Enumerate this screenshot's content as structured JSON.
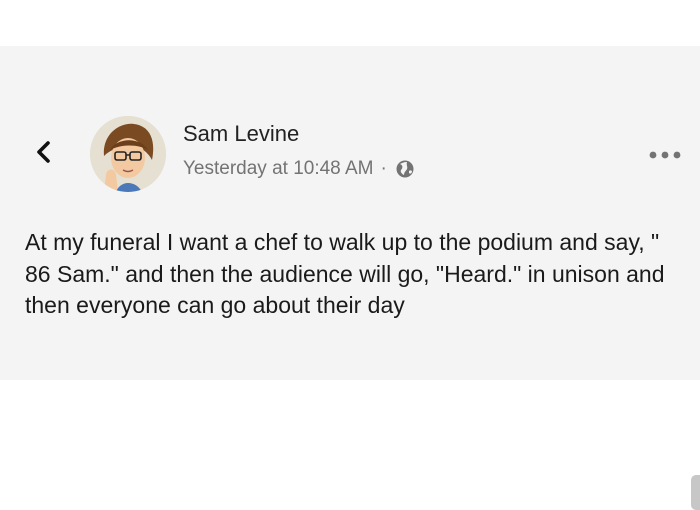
{
  "post": {
    "author": "Sam Levine",
    "timestamp": "Yesterday at 10:48 AM",
    "separator": "·",
    "privacy_icon": "globe-icon",
    "back_icon": "chevron-left-icon",
    "more_icon": "more-dots-icon",
    "text": "At my funeral I want a chef to walk up to the podium and say, \" 86 Sam.\" and then the audience will go, \"Heard.\" in unison and then everyone can go about their day"
  },
  "colors": {
    "card_background": "#f4f4f4",
    "page_background": "#ffffff",
    "name_text": "#222222",
    "meta_text": "#737373",
    "body_text": "#1a1a1a"
  }
}
